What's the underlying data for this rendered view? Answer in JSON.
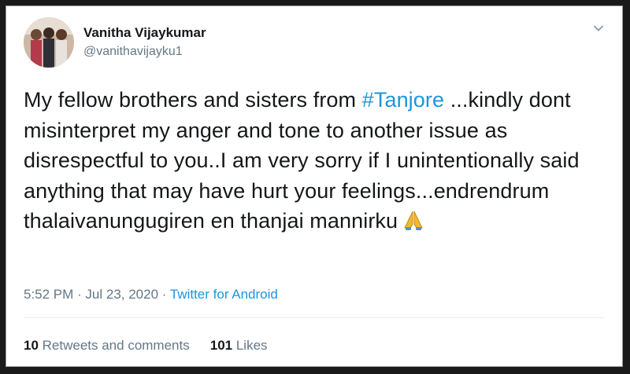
{
  "tweet": {
    "author": {
      "display_name": "Vanitha Vijaykumar",
      "handle": "@vanithavijayku1"
    },
    "text": {
      "before_hashtag": "My fellow brothers and sisters from ",
      "hashtag": "#Tanjore",
      "after_hashtag": " ...kindly dont misinterpret my anger and tone to another issue as disrespectful to you..I am very sorry if I unintentionally said anything that may have hurt your feelings...endrendrum thalaivanungugiren en thanjai mannirku",
      "emoji_icon": "folded-hands-icon"
    },
    "meta": {
      "timestamp": "5:52 PM · Jul 23, 2020",
      "separator": " · ",
      "source": "Twitter for Android"
    },
    "stats": {
      "retweets_count": "10",
      "retweets_label": " Retweets and comments",
      "likes_count": "101",
      "likes_label": " Likes"
    },
    "icons": {
      "menu": "chevron-down-icon"
    },
    "colors": {
      "link": "#1b95e0",
      "text": "#14171a",
      "muted": "#657786",
      "emoji": "#f5b82e"
    }
  }
}
